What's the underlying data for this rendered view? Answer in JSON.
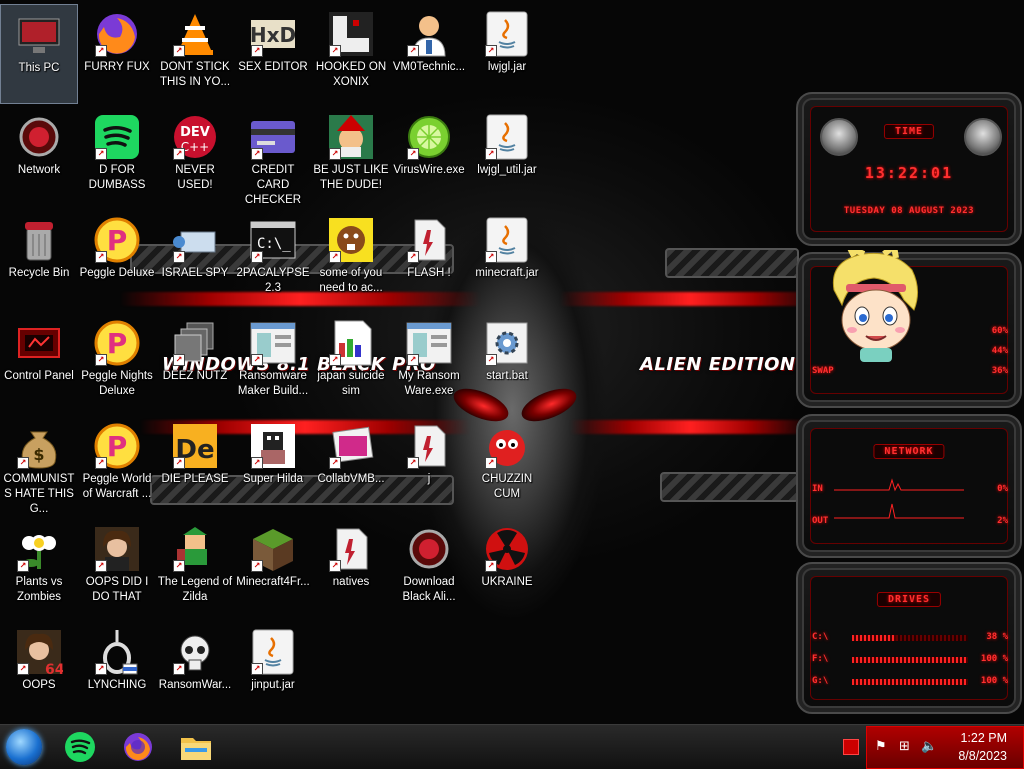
{
  "wallpaper": {
    "text_left": "WINDOWS 8.1 BLACK PRO",
    "text_right": "ALIEN EDITION 20"
  },
  "icons": [
    {
      "label": "This PC",
      "icon": "this-pc-icon",
      "selected": true
    },
    {
      "label": "FURRY FUX",
      "icon": "firefox-icon"
    },
    {
      "label": "DONT STICK THIS IN YO...",
      "icon": "vlc-icon"
    },
    {
      "label": "SEX EDITOR",
      "icon": "hxd-icon"
    },
    {
      "label": "HOOKED ON XONIX",
      "icon": "xonix-icon"
    },
    {
      "label": "VM0Technic...",
      "icon": "doctor-icon"
    },
    {
      "label": "lwjgl.jar",
      "icon": "java-icon"
    },
    {
      "label": "Network",
      "icon": "alien-network-icon"
    },
    {
      "label": "D FOR DUMBASS",
      "icon": "spotify-icon"
    },
    {
      "label": "NEVER USED!",
      "icon": "devcpp-icon"
    },
    {
      "label": "CREDIT CARD CHECKER",
      "icon": "credit-card-icon"
    },
    {
      "label": "BE JUST LIKE THE DUDE!",
      "icon": "elf-icon"
    },
    {
      "label": "VirusWire.exe",
      "icon": "limewire-icon"
    },
    {
      "label": "lwjgl_util.jar",
      "icon": "java-icon"
    },
    {
      "label": "Recycle Bin",
      "icon": "recycle-bin-icon"
    },
    {
      "label": "Peggle Deluxe",
      "icon": "peggle-icon"
    },
    {
      "label": "ISRAEL SPY",
      "icon": "spy-icon"
    },
    {
      "label": "2PACALYPSE 2.3",
      "icon": "cmd-icon"
    },
    {
      "label": "some of you need to ac...",
      "icon": "beaver-icon"
    },
    {
      "label": "FLASH !",
      "icon": "flash-icon"
    },
    {
      "label": "minecraft.jar",
      "icon": "java-icon"
    },
    {
      "label": "Control Panel",
      "icon": "control-panel-icon"
    },
    {
      "label": "Peggle Nights Deluxe",
      "icon": "peggle-icon"
    },
    {
      "label": "DEEZ NUTZ",
      "icon": "windows-stack-icon"
    },
    {
      "label": "Ransomware Maker Build...",
      "icon": "app-window-icon"
    },
    {
      "label": "japan suicide sim",
      "icon": "paint-icon"
    },
    {
      "label": "My Ransom Ware.exe",
      "icon": "app-window-icon"
    },
    {
      "label": "start.bat",
      "icon": "batch-gear-icon"
    },
    {
      "label": "COMMUNISTS HATE THIS G...",
      "icon": "money-bag-icon"
    },
    {
      "label": "Peggle World of Warcraft ...",
      "icon": "peggle-icon"
    },
    {
      "label": "DIE PLEASE",
      "icon": "director-icon"
    },
    {
      "label": "Super Hilda",
      "icon": "pixel-icon"
    },
    {
      "label": "CollabVMB...",
      "icon": "collabvm-icon"
    },
    {
      "label": "j",
      "icon": "flash-icon"
    },
    {
      "label": "CHUZZIN CUM",
      "icon": "chuzzle-icon"
    },
    {
      "label": "Plants vs Zombies",
      "icon": "plant-icon"
    },
    {
      "label": "OOPS DID I DO THAT",
      "icon": "portrait-icon"
    },
    {
      "label": "The Legend of Zilda",
      "icon": "link-sprite-icon"
    },
    {
      "label": "Minecraft4Fr...",
      "icon": "grass-block-icon"
    },
    {
      "label": "natives",
      "icon": "flash-icon"
    },
    {
      "label": "Download Black Ali...",
      "icon": "alien-network-icon"
    },
    {
      "label": "UKRAINE",
      "icon": "radiation-icon"
    },
    {
      "label": "OOPS",
      "icon": "portrait-64-icon"
    },
    {
      "label": "LYNCHING",
      "icon": "noose-icon"
    },
    {
      "label": "RansomWar...",
      "icon": "skull-icon"
    },
    {
      "label": "jinput.jar",
      "icon": "java-icon"
    }
  ],
  "gadgets": {
    "time": {
      "title": "TIME",
      "clock": "13:22:01",
      "date": "TUESDAY 08 AUGUST 2023"
    },
    "system": {
      "swap_label": "SWAP",
      "rows": [
        {
          "value": "60%"
        },
        {
          "value": "44%"
        },
        {
          "value": "36%"
        }
      ]
    },
    "network": {
      "title": "NETWORK",
      "in_label": "IN",
      "in_value": "0%",
      "out_label": "OUT",
      "out_value": "2%"
    },
    "drives": {
      "title": "DRIVES",
      "rows": [
        {
          "label": "C:\\",
          "value": "38 %",
          "fill": 0.38
        },
        {
          "label": "F:\\",
          "value": "100 %",
          "fill": 1.0
        },
        {
          "label": "G:\\",
          "value": "100 %",
          "fill": 1.0
        }
      ]
    }
  },
  "taskbar": {
    "pinned": [
      "spotify-icon",
      "firefox-icon",
      "file-explorer-icon"
    ],
    "time": "1:22 PM",
    "date": "8/8/2023"
  }
}
